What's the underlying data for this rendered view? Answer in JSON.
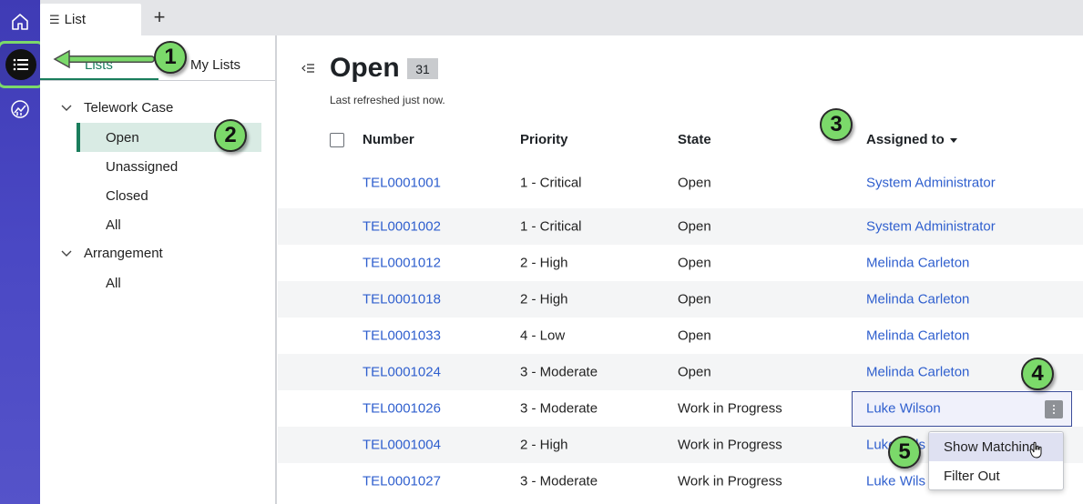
{
  "tabbar": {
    "tab_label": "List",
    "add_label": "+"
  },
  "sidebar": {
    "tabs": [
      "Lists",
      "My Lists"
    ],
    "groups": [
      {
        "label": "Telework Case",
        "items": [
          "Open",
          "Unassigned",
          "Closed",
          "All"
        ]
      },
      {
        "label": "Arrangement",
        "items": [
          "All"
        ]
      }
    ]
  },
  "main": {
    "title": "Open",
    "count": "31",
    "refreshed": "Last refreshed just now.",
    "columns": [
      "Number",
      "Priority",
      "State",
      "Assigned to"
    ],
    "rows": [
      {
        "number": "TEL0001001",
        "priority": "1 - Critical",
        "state": "Open",
        "assigned": "System Administrator"
      },
      {
        "number": "TEL0001002",
        "priority": "1 - Critical",
        "state": "Open",
        "assigned": "System Administrator"
      },
      {
        "number": "TEL0001012",
        "priority": "2 - High",
        "state": "Open",
        "assigned": "Melinda Carleton"
      },
      {
        "number": "TEL0001018",
        "priority": "2 - High",
        "state": "Open",
        "assigned": "Melinda Carleton"
      },
      {
        "number": "TEL0001033",
        "priority": "4 - Low",
        "state": "Open",
        "assigned": "Melinda Carleton"
      },
      {
        "number": "TEL0001024",
        "priority": "3 - Moderate",
        "state": "Open",
        "assigned": "Melinda Carleton"
      },
      {
        "number": "TEL0001026",
        "priority": "3 - Moderate",
        "state": "Work in Progress",
        "assigned": "Luke Wilson"
      },
      {
        "number": "TEL0001004",
        "priority": "2 - High",
        "state": "Work in Progress",
        "assigned": "Luke Wils"
      },
      {
        "number": "TEL0001027",
        "priority": "3 - Moderate",
        "state": "Work in Progress",
        "assigned": "Luke Wils"
      }
    ]
  },
  "context_menu": {
    "items": [
      "Show Matching",
      "Filter Out"
    ]
  },
  "callouts": [
    "1",
    "2",
    "3",
    "4",
    "5"
  ],
  "colors": {
    "rail": "#4a48c4",
    "accent": "#1a7d5c",
    "link": "#2f5fce",
    "callout": "#7bd96a"
  }
}
